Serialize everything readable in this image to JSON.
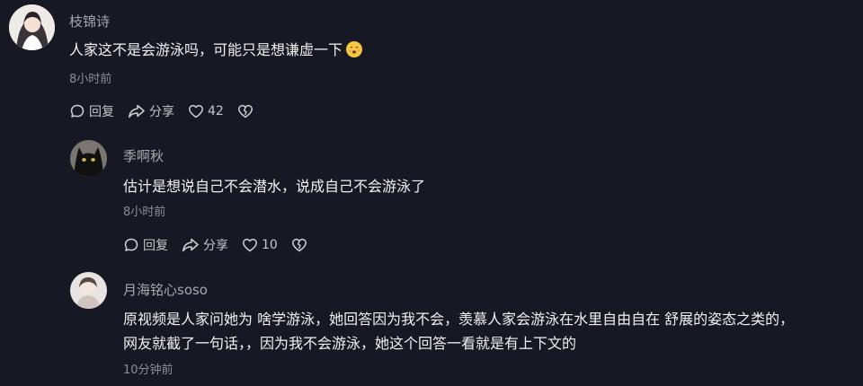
{
  "comments": [
    {
      "username": "枝锦诗",
      "text": "人家这不是会游泳吗，可能只是想谦虚一下",
      "emoji": "smiling-face-emoji",
      "time": "8小时前",
      "reply_label": "回复",
      "share_label": "分享",
      "like_count": "42"
    },
    {
      "username": "季啊秋",
      "text": "估计是想说自己不会潜水，说成自己不会游泳了",
      "time": "8小时前",
      "reply_label": "回复",
      "share_label": "分享",
      "like_count": "10"
    },
    {
      "username": "月海铭心soso",
      "text_line1": "原视频是人家问她为 啥学游泳，她回答因为我不会，羡慕人家会游泳在水里自由自在 舒展的姿态之类的，",
      "text_line2": "网友就截了一句话，，因为我不会游泳，她这个回答一看就是有上下文的",
      "time": "10分钟前"
    }
  ],
  "colors": {
    "background": "#161823",
    "text_primary": "#ffffff",
    "text_secondary": "#8a8b91"
  },
  "icons": [
    "reply-icon",
    "share-icon",
    "heart-icon",
    "broken-heart-icon"
  ]
}
